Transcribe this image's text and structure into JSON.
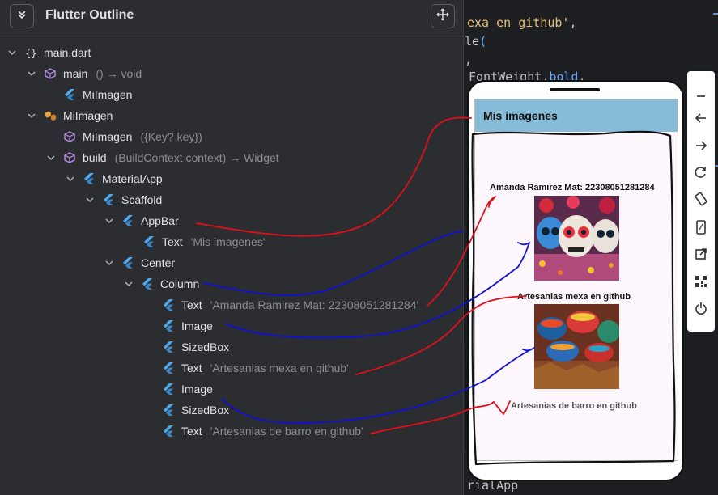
{
  "editor": {
    "line1": {
      "string": "exa en github'",
      "tail": ","
    },
    "line2": {
      "name": "yle",
      "paren": "("
    },
    "line3": {
      "text": "),"
    },
    "line4": {
      "class": "FontWeight",
      "dot": ".",
      "member": "bold",
      "tail": ","
    },
    "line5": {
      "text": "rialApp"
    }
  },
  "outline": {
    "title": "Flutter Outline",
    "collapse_icon": "collapse-all-icon",
    "move_icon": "move-arrows-icon",
    "tree": [
      {
        "label": "main.dart",
        "detail": "",
        "icon": "braces-icon"
      },
      {
        "label": "main",
        "detail": "() → void",
        "icon": "cube-icon"
      },
      {
        "label": "MiImagen",
        "detail": "",
        "icon": "flutter-icon"
      },
      {
        "label": "MiImagen",
        "detail": "",
        "icon": "class-icon"
      },
      {
        "label": "MiImagen",
        "detail": "({Key? key})",
        "icon": "cube-icon"
      },
      {
        "label": "build",
        "detail": "(BuildContext context) → Widget",
        "icon": "cube-icon"
      },
      {
        "label": "MaterialApp",
        "detail": "",
        "icon": "flutter-icon"
      },
      {
        "label": "Scaffold",
        "detail": "",
        "icon": "flutter-icon"
      },
      {
        "label": "AppBar",
        "detail": "",
        "icon": "flutter-icon"
      },
      {
        "label": "Text",
        "detail": "'Mis imagenes'",
        "icon": "flutter-icon"
      },
      {
        "label": "Center",
        "detail": "",
        "icon": "flutter-icon"
      },
      {
        "label": "Column",
        "detail": "",
        "icon": "flutter-icon"
      },
      {
        "label": "Text",
        "detail": "'Amanda Ramirez Mat: 22308051281284'",
        "icon": "flutter-icon"
      },
      {
        "label": "Image",
        "detail": "",
        "icon": "flutter-icon"
      },
      {
        "label": "SizedBox",
        "detail": "",
        "icon": "flutter-icon"
      },
      {
        "label": "Text",
        "detail": "'Artesanias mexa en github'",
        "icon": "flutter-icon"
      },
      {
        "label": "Image",
        "detail": "",
        "icon": "flutter-icon"
      },
      {
        "label": "SizedBox",
        "detail": "",
        "icon": "flutter-icon"
      },
      {
        "label": "Text",
        "detail": "'Artesanias de barro en github'",
        "icon": "flutter-icon"
      }
    ]
  },
  "phone_app": {
    "appbar_title": "Mis imagenes",
    "text1": "Amanda Ramirez Mat: 22308051281284",
    "image1": "sugar-skulls-photo",
    "text2": "Artesanias mexa en github",
    "image2": "clay-pottery-photo",
    "text3": "Artesanias de barro en github"
  },
  "emulator_toolbar": [
    "minimize-icon",
    "back-icon",
    "forward-icon",
    "rotate-icon",
    "rotate-device-icon",
    "phone-icon",
    "external-link-icon",
    "qr-code-icon",
    "power-icon"
  ],
  "colors": {
    "panel_bg": "#2b2d30",
    "appbar": "#86bcd8",
    "flutter_blue": "#4fa8e8",
    "cube_purple": "#b88ee8",
    "annotation_red": "#e0101a",
    "annotation_blue": "#1010d8"
  }
}
